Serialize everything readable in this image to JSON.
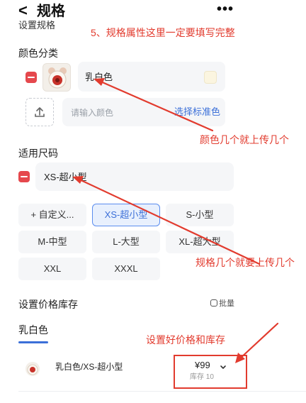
{
  "header": {
    "back_glyph": "<",
    "title": "规格",
    "more_glyph": "•••"
  },
  "section_cut_title": "设置规格",
  "annotations": {
    "note_top": "5、规格属性这里一定要填写完整",
    "note_color": "颜色几个就上传几个",
    "note_size": "规格几个就要上传几个",
    "note_price": "设置好价格和库存"
  },
  "color_section": {
    "title": "颜色分类",
    "items": [
      {
        "name": "乳白色"
      }
    ],
    "input_placeholder": "请输入颜色",
    "standard_link": "选择标准色"
  },
  "size_section": {
    "title": "适用尺码",
    "selected_item": "XS-超小型",
    "chips": [
      "+ 自定义...",
      "XS-超小型",
      "S-小型",
      "M-中型",
      "L-大型",
      "XL-超大型",
      "XXL",
      "XXXL"
    ]
  },
  "price_section": {
    "title": "设置价格库存",
    "batch_label": "批量",
    "tab": "乳白色",
    "sku": {
      "name": "乳白色/XS-超小型",
      "price": "¥99",
      "stock": "库存 10"
    }
  },
  "colors": {
    "accent_blue": "#3b6fd8",
    "annotation_red": "#e23b2e",
    "delete_red": "#e5484d"
  },
  "icons": [
    "back-icon",
    "more-icon",
    "delete-icon",
    "upload-icon",
    "batch-icon",
    "chevron-down-icon"
  ]
}
